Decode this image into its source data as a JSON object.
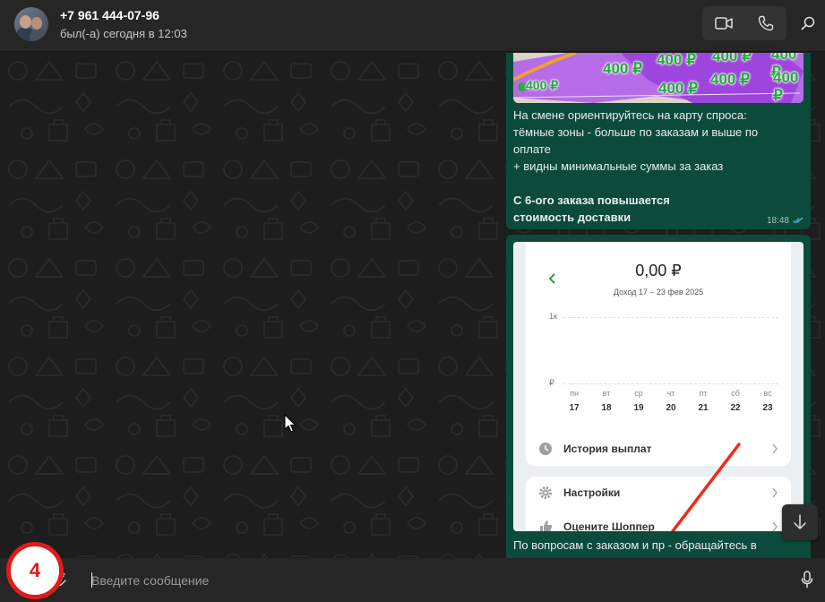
{
  "header": {
    "contact_name": "+7 961 444-07-96",
    "last_seen": "был(-а) сегодня в 12:03",
    "icons": [
      "avatar",
      "video-call-icon",
      "voice-call-icon",
      "search-icon"
    ]
  },
  "messages": [
    {
      "map_prices": [
        "400 ₽",
        "400 ₽",
        "400 ₽",
        "400 ₽",
        "400 ₽",
        "400 ₽",
        "400 ₽",
        "400 ₽"
      ],
      "lines": [
        "На смене ориентируйтесь на карту спроса:",
        "тёмные зоны - больше по заказам и выше по",
        "оплате",
        "+ видны минимальные суммы за заказ"
      ],
      "bold_lines": [
        "С 6-ого заказа повышается",
        "стоимость доставки"
      ],
      "time": "18:48",
      "status": "read"
    },
    {
      "screenshot": {
        "amount": "0,00 ₽",
        "period": "Доход 17 – 23 фев 2025",
        "y_top": "1к",
        "y_bottom": "₽",
        "days": [
          "пн",
          "вт",
          "ср",
          "чт",
          "пт",
          "сб",
          "вс"
        ],
        "dates": [
          "17",
          "18",
          "19",
          "20",
          "21",
          "22",
          "23"
        ],
        "history": "История выплат",
        "settings": "Настройки",
        "rate": "Оцените Шоппер"
      },
      "text": "По вопросам с заказом и пр - обращайтесь в"
    }
  ],
  "composer": {
    "placeholder": "Введите сообщение"
  },
  "overlay": {
    "step_number": "4"
  },
  "colors": {
    "bubble": "#0c4a3b",
    "accent": "#1faa3a",
    "badge_red": "#e01b1b"
  }
}
